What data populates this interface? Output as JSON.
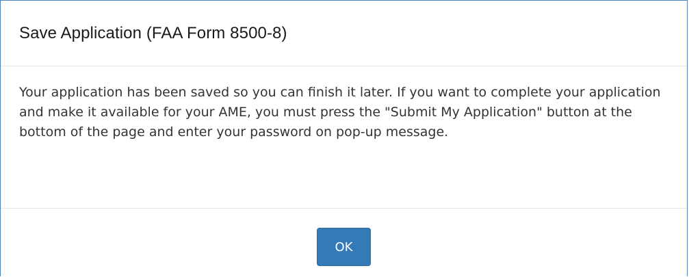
{
  "dialog": {
    "title": "Save Application (FAA Form 8500-8)",
    "message": "Your application has been saved so you can finish it later. If you want to complete your application and make it available for your AME, you must press the \"Submit My Application\" button at the bottom of the page and enter your password on pop-up message.",
    "ok_label": "OK"
  },
  "colors": {
    "dialog_border": "#4f81bd",
    "button_primary": "#337ab7",
    "divider": "#e5e5e5"
  }
}
